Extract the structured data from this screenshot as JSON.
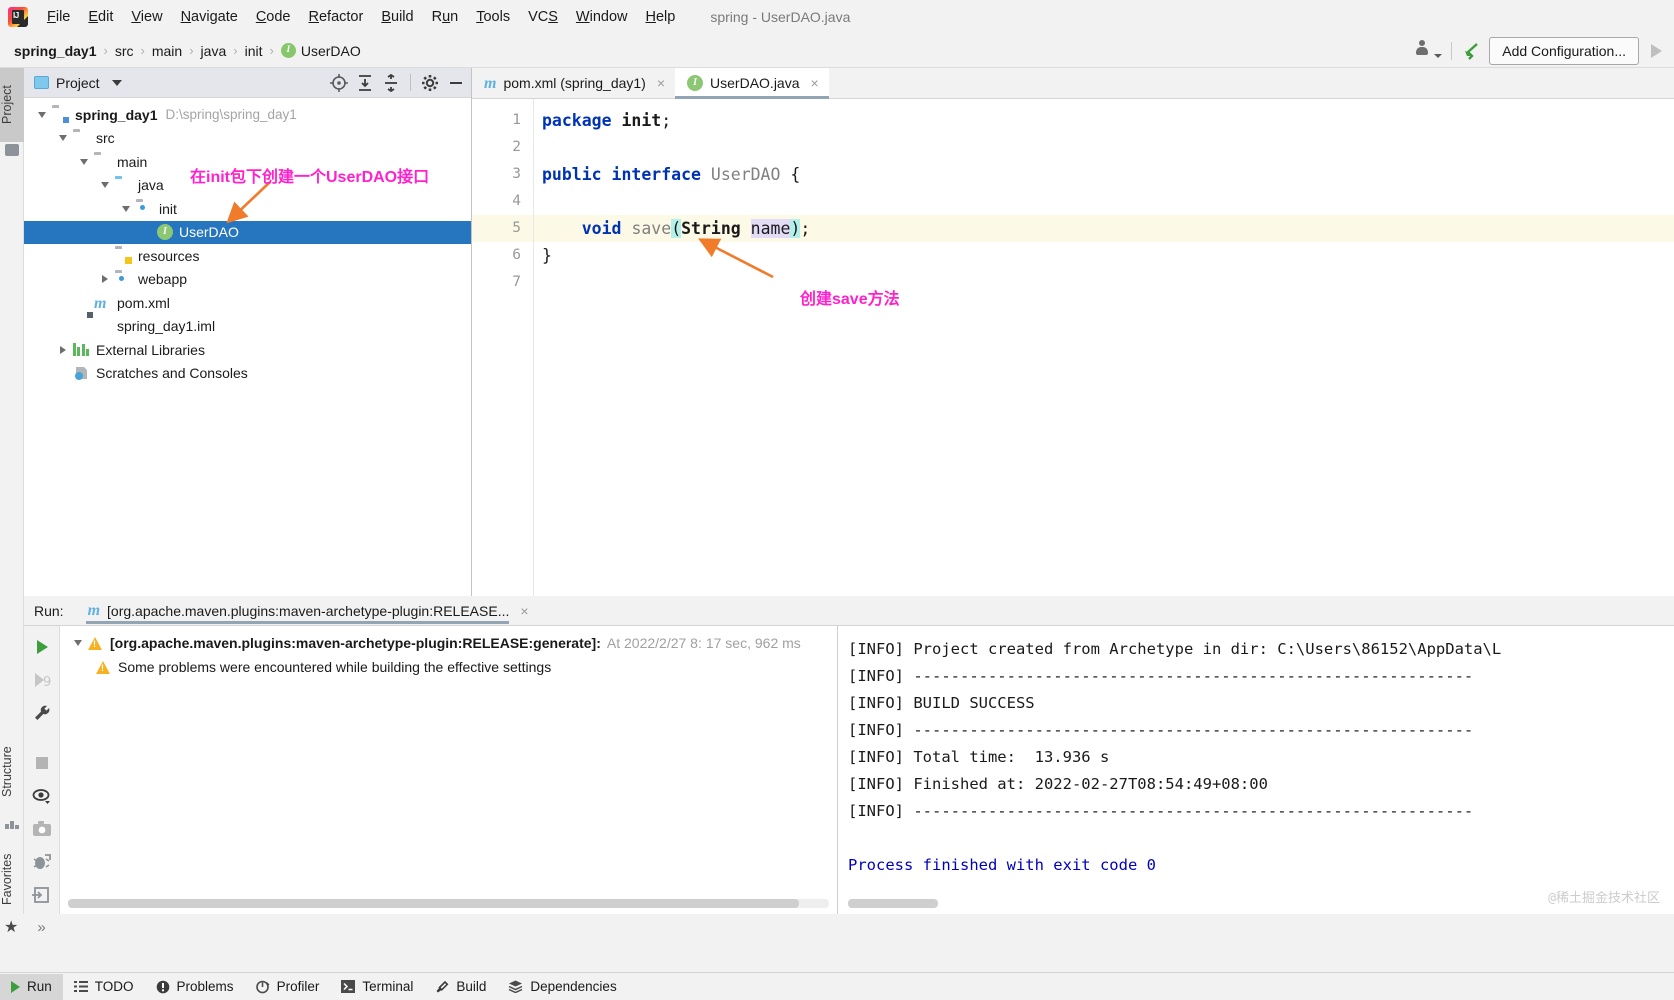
{
  "window": {
    "title": "spring - UserDAO.java"
  },
  "menubar": {
    "items": [
      {
        "label": "File",
        "mnemonic": "F"
      },
      {
        "label": "Edit",
        "mnemonic": "E"
      },
      {
        "label": "View",
        "mnemonic": "V"
      },
      {
        "label": "Navigate",
        "mnemonic": "N"
      },
      {
        "label": "Code",
        "mnemonic": "C"
      },
      {
        "label": "Refactor",
        "mnemonic": "R"
      },
      {
        "label": "Build",
        "mnemonic": "B"
      },
      {
        "label": "Run",
        "mnemonic": "u"
      },
      {
        "label": "Tools",
        "mnemonic": "T"
      },
      {
        "label": "VCS",
        "mnemonic": "S"
      },
      {
        "label": "Window",
        "mnemonic": "W"
      },
      {
        "label": "Help",
        "mnemonic": "H"
      }
    ]
  },
  "navbar": {
    "breadcrumbs": [
      {
        "label": "spring_day1",
        "bold": true,
        "icon": null
      },
      {
        "label": "src",
        "bold": false,
        "icon": null
      },
      {
        "label": "main",
        "bold": false,
        "icon": null
      },
      {
        "label": "java",
        "bold": false,
        "icon": null
      },
      {
        "label": "init",
        "bold": false,
        "icon": null
      },
      {
        "label": "UserDAO",
        "bold": false,
        "icon": "interface-badge"
      }
    ],
    "add_configuration_label": "Add Configuration...",
    "icons": [
      "person-dropdown-icon",
      "build-hammer-icon",
      "run-play-icon"
    ]
  },
  "left_strip": {
    "top_tabs": [
      {
        "label": "Project",
        "active": true
      }
    ],
    "bottom_tabs": [
      {
        "label": "Structure",
        "active": false
      },
      {
        "label": "Favorites",
        "active": false
      }
    ],
    "icons": [
      "project-folder-icon",
      "structure-icon",
      "favorites-star-icon"
    ]
  },
  "project_panel": {
    "header": {
      "title": "Project",
      "icons": [
        "locate-target-icon",
        "expand-all-icon",
        "collapse-all-icon",
        "settings-gear-icon",
        "hide-minus-icon"
      ]
    },
    "tree": [
      {
        "id": "spring_day1",
        "label": "spring_day1",
        "path": "D:\\spring\\spring_day1",
        "depth": 0,
        "icon": "module-folder-icon",
        "expanded": true,
        "bold": true,
        "selected": false
      },
      {
        "id": "src",
        "label": "src",
        "path": "",
        "depth": 1,
        "icon": "folder-icon",
        "expanded": true,
        "bold": false,
        "selected": false
      },
      {
        "id": "main",
        "label": "main",
        "path": "",
        "depth": 2,
        "icon": "folder-icon",
        "expanded": true,
        "bold": false,
        "selected": false
      },
      {
        "id": "java",
        "label": "java",
        "path": "",
        "depth": 3,
        "icon": "source-folder-icon",
        "expanded": true,
        "bold": false,
        "selected": false
      },
      {
        "id": "init",
        "label": "init",
        "path": "",
        "depth": 4,
        "icon": "package-folder-icon",
        "expanded": true,
        "bold": false,
        "selected": false
      },
      {
        "id": "UserDAO",
        "label": "UserDAO",
        "path": "",
        "depth": 5,
        "icon": "interface-icon",
        "expanded": null,
        "bold": false,
        "selected": true
      },
      {
        "id": "resources",
        "label": "resources",
        "path": "",
        "depth": 3,
        "icon": "resources-folder-icon",
        "expanded": null,
        "bold": false,
        "selected": false
      },
      {
        "id": "webapp",
        "label": "webapp",
        "path": "",
        "depth": 3,
        "icon": "webapp-folder-icon",
        "expanded": false,
        "bold": false,
        "selected": false
      },
      {
        "id": "pom.xml",
        "label": "pom.xml",
        "path": "",
        "depth": 2,
        "icon": "maven-icon",
        "expanded": null,
        "bold": false,
        "selected": false
      },
      {
        "id": "spring_day1.iml",
        "label": "spring_day1.iml",
        "path": "",
        "depth": 2,
        "icon": "iml-icon",
        "expanded": null,
        "bold": false,
        "selected": false
      },
      {
        "id": "External Libraries",
        "label": "External Libraries",
        "path": "",
        "depth": 1,
        "icon": "libraries-icon",
        "expanded": false,
        "bold": false,
        "selected": false
      },
      {
        "id": "Scratches and Consoles",
        "label": "Scratches and Consoles",
        "path": "",
        "depth": 1,
        "icon": "scratches-icon",
        "expanded": null,
        "bold": false,
        "selected": false
      }
    ]
  },
  "annotations": [
    {
      "id": "ann-init-pkg",
      "text": "在init包下创建一个UserDAO接口",
      "color": "#ff22cc"
    },
    {
      "id": "ann-save-method",
      "text": "创建save方法",
      "color": "#ff22cc"
    }
  ],
  "editor": {
    "tabs": [
      {
        "label": "pom.xml (spring_day1)",
        "icon": "maven-icon",
        "active": false,
        "close": "×"
      },
      {
        "label": "UserDAO.java",
        "icon": "interface-icon",
        "active": true,
        "close": "×"
      }
    ],
    "gutter_numbers": [
      "1",
      "2",
      "3",
      "4",
      "5",
      "6",
      "7"
    ],
    "highlight_line": 5,
    "lines": [
      {
        "n": 1,
        "tokens": [
          {
            "t": "package",
            "c": "kw"
          },
          {
            "t": " ",
            "c": "plain"
          },
          {
            "t": "init",
            "c": "plain-bold"
          },
          {
            "t": ";",
            "c": "plain"
          }
        ]
      },
      {
        "n": 2,
        "tokens": []
      },
      {
        "n": 3,
        "tokens": [
          {
            "t": "public",
            "c": "kw"
          },
          {
            "t": " ",
            "c": "plain"
          },
          {
            "t": "interface",
            "c": "kw"
          },
          {
            "t": " ",
            "c": "plain"
          },
          {
            "t": "UserDAO",
            "c": "cls"
          },
          {
            "t": " ",
            "c": "plain"
          },
          {
            "t": "{",
            "c": "plain"
          }
        ]
      },
      {
        "n": 4,
        "tokens": []
      },
      {
        "n": 5,
        "tokens": [
          {
            "t": "    ",
            "c": "plain"
          },
          {
            "t": "void",
            "c": "kw"
          },
          {
            "t": " ",
            "c": "plain"
          },
          {
            "t": "save",
            "c": "cls"
          },
          {
            "t": "(",
            "c": "hl-paren"
          },
          {
            "t": "String",
            "c": "plain-bold"
          },
          {
            "t": " ",
            "c": "plain"
          },
          {
            "t": "name",
            "c": "hl-name"
          },
          {
            "t": ")",
            "c": "hl-paren"
          },
          {
            "t": ";",
            "c": "plain"
          }
        ]
      },
      {
        "n": 6,
        "tokens": [
          {
            "t": "}",
            "c": "plain"
          }
        ]
      },
      {
        "n": 7,
        "tokens": []
      }
    ]
  },
  "run_panel": {
    "label": "Run:",
    "tab_label": "[org.apache.maven.plugins:maven-archetype-plugin:RELEASE...",
    "tab_icon": "maven-icon",
    "tab_close": "×",
    "toolbar_icons": [
      "rerun-play-icon",
      "rerun-failed-icon",
      "settings-wrench-icon",
      "stop-icon",
      "filter-eye-icon",
      "screenshot-camera-icon",
      "debug-icon",
      "export-icon",
      "more-icon"
    ],
    "tree": [
      {
        "depth": 0,
        "expanded": true,
        "icon": "warning-icon",
        "bold_text": "[org.apache.maven.plugins:maven-archetype-plugin:RELEASE:generate]:",
        "dim_text": "At 2022/2/27 8:",
        "tail_text": "17 sec, 962 ms"
      },
      {
        "depth": 1,
        "expanded": null,
        "icon": "warning-icon",
        "bold_text": "",
        "dim_text": "",
        "plain_text": "Some problems were encountered while building the effective settings"
      }
    ],
    "console_lines": [
      {
        "text": "[INFO] Project created from Archetype in dir: C:\\Users\\86152\\AppData\\L",
        "color": "black"
      },
      {
        "text": "[INFO] ------------------------------------------------------------",
        "color": "black"
      },
      {
        "text": "[INFO] BUILD SUCCESS",
        "color": "black"
      },
      {
        "text": "[INFO] ------------------------------------------------------------",
        "color": "black"
      },
      {
        "text": "[INFO] Total time:  13.936 s",
        "color": "black"
      },
      {
        "text": "[INFO] Finished at: 2022-02-27T08:54:49+08:00",
        "color": "black"
      },
      {
        "text": "[INFO] ------------------------------------------------------------",
        "color": "black"
      },
      {
        "text": "",
        "color": "black"
      },
      {
        "text": "Process finished with exit code 0",
        "color": "blue"
      }
    ],
    "watermark": "@稀土掘金技术社区"
  },
  "statusbar": {
    "items": [
      {
        "label": "Run",
        "icon": "play-icon",
        "active": true
      },
      {
        "label": "TODO",
        "icon": "todo-list-icon",
        "active": false
      },
      {
        "label": "Problems",
        "icon": "problems-icon",
        "active": false
      },
      {
        "label": "Profiler",
        "icon": "profiler-icon",
        "active": false
      },
      {
        "label": "Terminal",
        "icon": "terminal-icon",
        "active": false
      },
      {
        "label": "Build",
        "icon": "build-hammer-icon",
        "active": false
      },
      {
        "label": "Dependencies",
        "icon": "dependencies-layers-icon",
        "active": false
      }
    ]
  }
}
